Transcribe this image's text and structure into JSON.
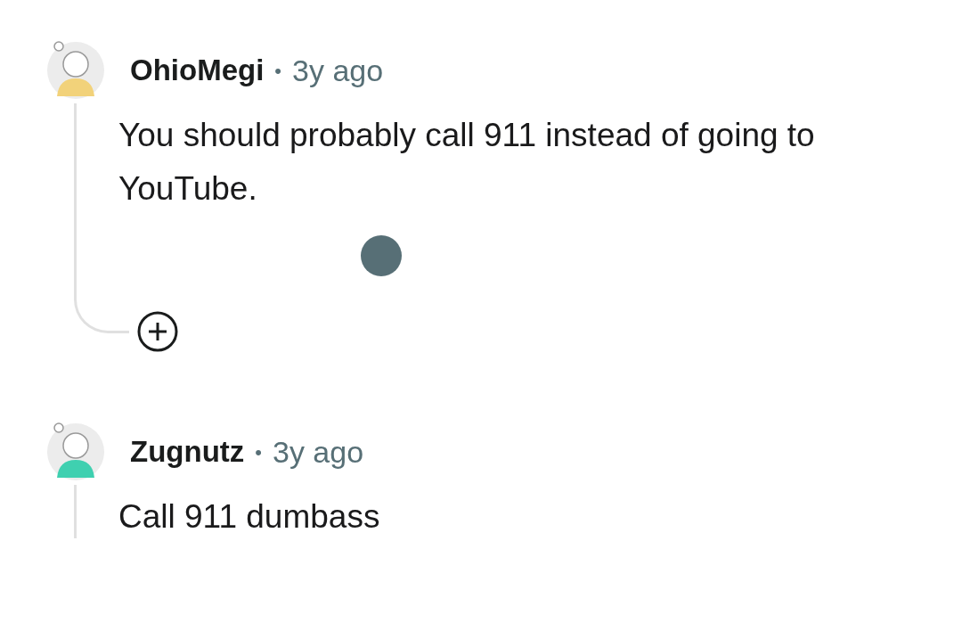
{
  "comments": [
    {
      "author": "OhioMegi",
      "separator": "•",
      "time": "3y ago",
      "body": "You should probably call 911 instead of going to YouTube.",
      "collapsed_replies": true
    },
    {
      "author": "Zugnutz",
      "separator": "•",
      "time": "3y ago",
      "body": "Call 911 dumbass",
      "collapsed_replies": false
    }
  ]
}
